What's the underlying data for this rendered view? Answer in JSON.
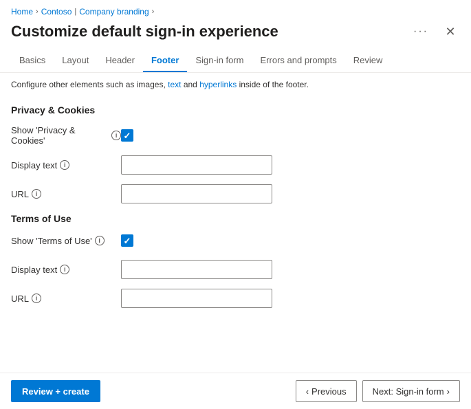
{
  "breadcrumb": {
    "items": [
      {
        "label": "Home",
        "url": "#"
      },
      {
        "label": "Contoso",
        "url": "#"
      },
      {
        "label": "Company branding",
        "url": "#"
      }
    ]
  },
  "header": {
    "title": "Customize default sign-in experience",
    "ellipsis_label": "···",
    "close_label": "✕"
  },
  "tabs": [
    {
      "id": "basics",
      "label": "Basics",
      "active": false
    },
    {
      "id": "layout",
      "label": "Layout",
      "active": false
    },
    {
      "id": "header",
      "label": "Header",
      "active": false
    },
    {
      "id": "footer",
      "label": "Footer",
      "active": true
    },
    {
      "id": "sign-in-form",
      "label": "Sign-in form",
      "active": false
    },
    {
      "id": "errors-and-prompts",
      "label": "Errors and prompts",
      "active": false
    },
    {
      "id": "review",
      "label": "Review",
      "active": false
    }
  ],
  "info_banner": {
    "text_before": "Configure other elements such as images,",
    "link1_label": "text",
    "text_middle": "and",
    "link2_label": "hyperlinks",
    "text_after": "inside of the footer."
  },
  "privacy_section": {
    "title": "Privacy & Cookies",
    "show_label": "Show 'Privacy & Cookies'",
    "show_checked": true,
    "display_text_label": "Display text",
    "display_text_value": "",
    "display_text_placeholder": "",
    "url_label": "URL",
    "url_value": "",
    "url_placeholder": ""
  },
  "terms_section": {
    "title": "Terms of Use",
    "show_label": "Show 'Terms of Use'",
    "show_checked": true,
    "display_text_label": "Display text",
    "display_text_value": "",
    "display_text_placeholder": "",
    "url_label": "URL",
    "url_value": "",
    "url_placeholder": ""
  },
  "footer": {
    "review_create_label": "Review + create",
    "previous_label": "Previous",
    "next_label": "Next: Sign-in form"
  }
}
